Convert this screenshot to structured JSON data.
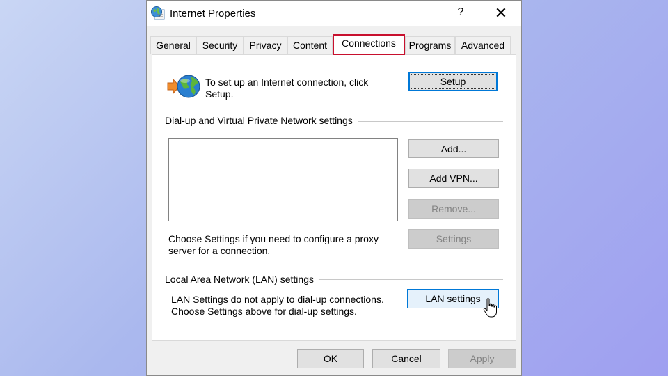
{
  "window": {
    "title": "Internet Properties",
    "help": "?",
    "close": "✕"
  },
  "tabs": [
    "General",
    "Security",
    "Privacy",
    "Content",
    "Connections",
    "Programs",
    "Advanced"
  ],
  "active_tab": "Connections",
  "setup": {
    "text": "To set up an Internet connection, click Setup.",
    "button": "Setup"
  },
  "dialup": {
    "label": "Dial-up and Virtual Private Network settings",
    "add": "Add...",
    "add_vpn": "Add VPN...",
    "remove": "Remove...",
    "settings": "Settings",
    "proxy_text": "Choose Settings if you need to configure a proxy server for a connection."
  },
  "lan": {
    "label": "Local Area Network (LAN) settings",
    "text": "LAN Settings do not apply to dial-up connections. Choose Settings above for dial-up settings.",
    "button": "LAN settings"
  },
  "footer": {
    "ok": "OK",
    "cancel": "Cancel",
    "apply": "Apply"
  },
  "colors": {
    "highlight": "#c8102e",
    "focus": "#0078d7"
  }
}
